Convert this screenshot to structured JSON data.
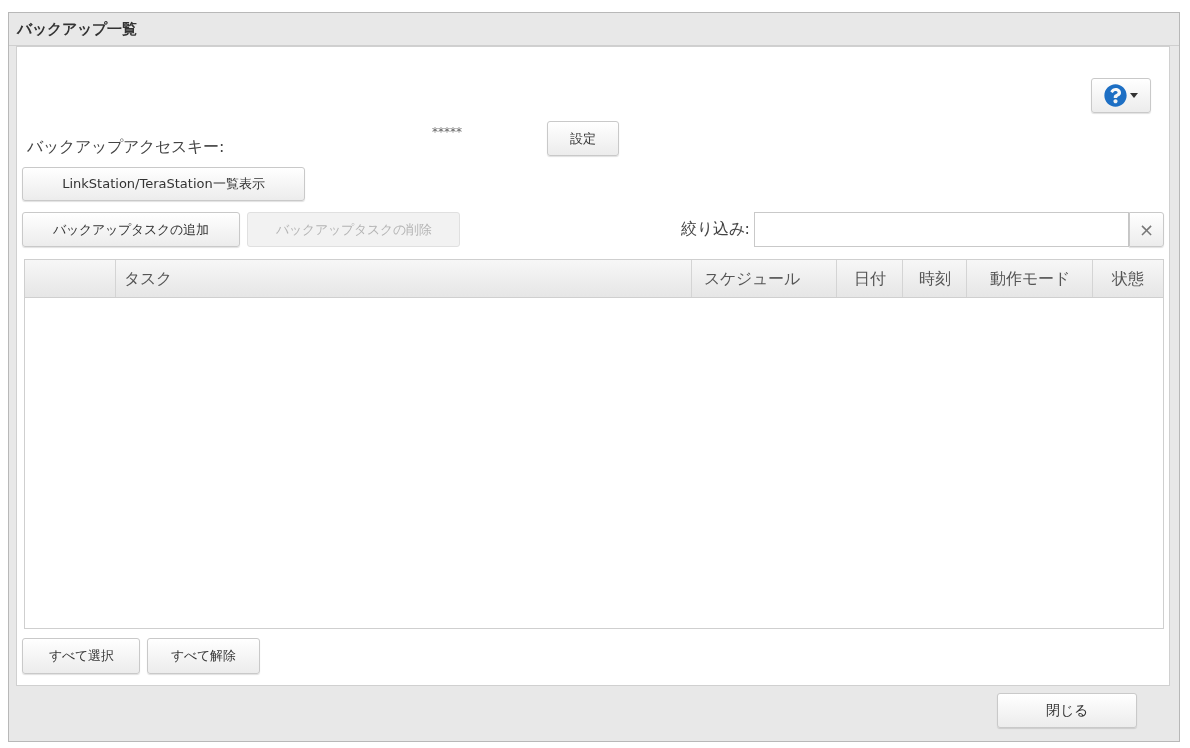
{
  "window": {
    "title": "バックアップ一覧"
  },
  "access_key": {
    "label": "バックアップアクセスキー:",
    "value": "*****",
    "button": "設定"
  },
  "list_button": "LinkStation/TeraStation一覧表示",
  "task_buttons": [
    {
      "label": "バックアップタスクの追加",
      "disabled": false
    },
    {
      "label": "バックアップタスクの削除",
      "disabled": true
    }
  ],
  "filter": {
    "label": "絞り込み:",
    "clear": "×"
  },
  "table": {
    "columns": [
      "タスク",
      "スケジュール",
      "日付",
      "時刻",
      "動作モード",
      "状態"
    ]
  },
  "selection_buttons": [
    "すべて選択",
    "すべて解除"
  ],
  "footer": {
    "close_button": "閉じる"
  }
}
